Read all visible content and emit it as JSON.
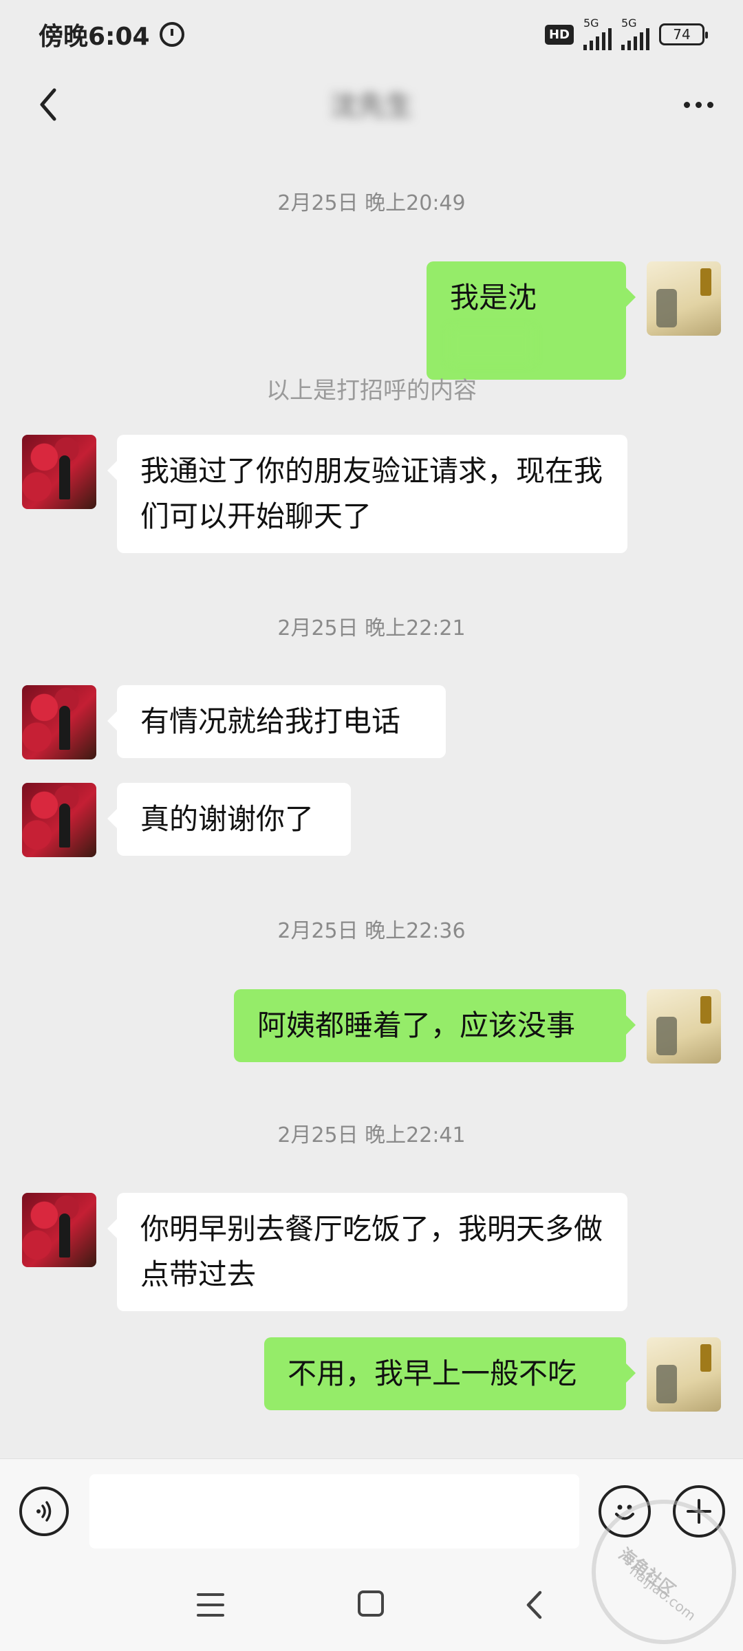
{
  "status_bar": {
    "time": "傍晚6:04",
    "network_1": "5G",
    "network_2": "5G",
    "hd_label": "HD",
    "battery": "74"
  },
  "header": {
    "title": "沈先生"
  },
  "chat": {
    "ts1": "2月25日 晚上20:49",
    "msg1": "我是沈",
    "system_note": "以上是打招呼的内容",
    "msg2": "我通过了你的朋友验证请求，现在我们可以开始聊天了",
    "ts2": "2月25日 晚上22:21",
    "msg3": "有情况就给我打电话",
    "msg4": "真的谢谢你了",
    "ts3": "2月25日 晚上22:36",
    "msg5": "阿姨都睡着了，应该没事",
    "ts4": "2月25日 晚上22:41",
    "msg6": "你明早别去餐厅吃饭了，我明天多做点带过去",
    "msg7": "不用，我早上一般不吃"
  },
  "input_bar": {
    "placeholder": ""
  },
  "watermark": {
    "title": "海角社区",
    "url": "haijiao.com"
  },
  "icons": {
    "back": "chevron-left-icon",
    "more": "more-dots-icon",
    "voice": "voice-icon",
    "emoji": "emoji-icon",
    "plus": "plus-icon"
  }
}
